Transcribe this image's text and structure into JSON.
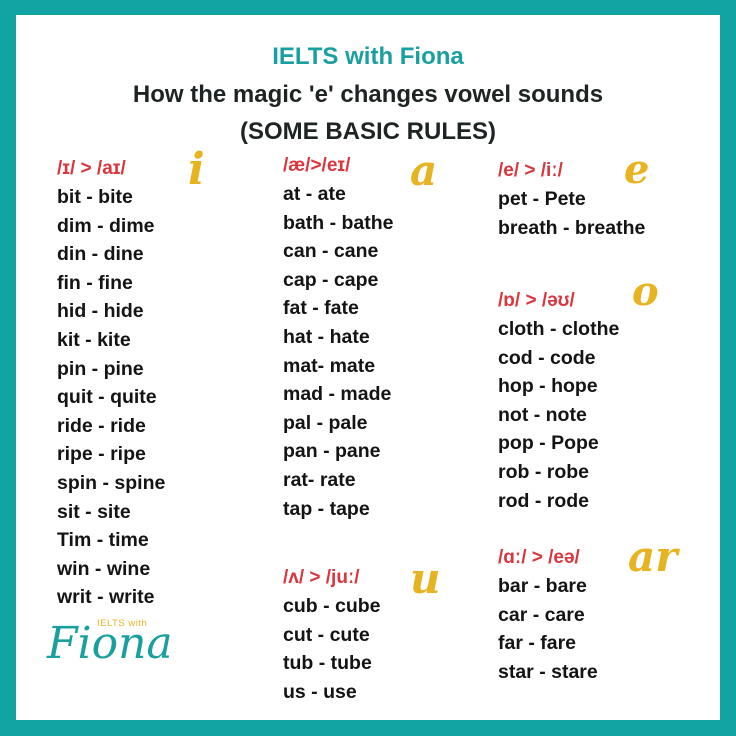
{
  "header": {
    "brand": "IELTS with Fiona",
    "title": "How the magic 'e' changes vowel sounds",
    "subtitle": "(SOME BASIC RULES)"
  },
  "colors": {
    "border": "#12a3a3",
    "brand_teal": "#1a9f9f",
    "ipa_red": "#d9363e",
    "letter_gold": "#e8b321"
  },
  "groups": [
    {
      "letter": "i",
      "ipa": "/ɪ/ > /aɪ/",
      "pairs": [
        "bit - bite",
        "dim - dime",
        "din - dine",
        "fin - fine",
        "hid - hide",
        "kit - kite",
        "pin - pine",
        "quit - quite",
        "ride - ride",
        "ripe - ripe",
        "spin - spine",
        "sit - site",
        "Tim - time",
        "win - wine",
        "writ - write"
      ]
    },
    {
      "letter": "a",
      "ipa": "/æ/>/eɪ/",
      "pairs": [
        "at - ate",
        "bath - bathe",
        "can - cane",
        "cap - cape",
        "fat - fate",
        "hat - hate",
        "mat- mate",
        "mad - made",
        "pal - pale",
        "pan - pane",
        "rat- rate",
        "tap - tape"
      ]
    },
    {
      "letter": "u",
      "ipa": "/ʌ/ > /juː/",
      "pairs": [
        "cub - cube",
        "cut - cute",
        "tub - tube",
        "us - use"
      ]
    },
    {
      "letter": "e",
      "ipa": "/e/ > /iː/",
      "pairs": [
        "pet - Pete",
        "breath - breathe"
      ]
    },
    {
      "letter": "o",
      "ipa": "/ɒ/ > /əʊ/",
      "pairs": [
        "cloth - clothe",
        "cod - code",
        "hop - hope",
        "not - note",
        "pop - Pope",
        "rob - robe",
        "rod - rode"
      ]
    },
    {
      "letter": "ar",
      "ipa": "/ɑː/ > /eə/",
      "pairs": [
        "bar - bare",
        "car - care",
        "far - fare",
        "star - stare"
      ]
    }
  ],
  "logo": {
    "small_text": "IELTS with",
    "big_text": "Fiona"
  }
}
